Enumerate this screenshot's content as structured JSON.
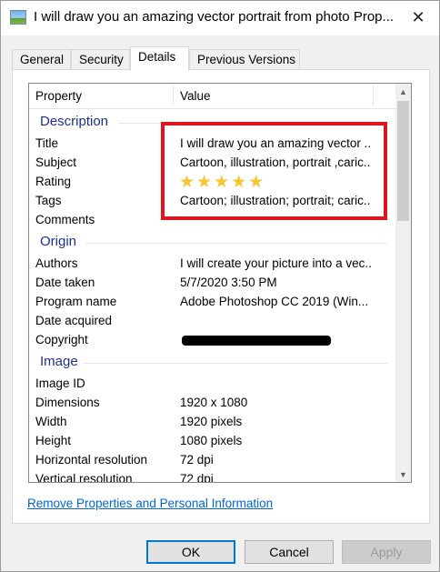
{
  "window": {
    "title": "I will draw you an amazing vector portrait from photo Prop...",
    "close_glyph": "✕"
  },
  "tabs": [
    {
      "label": "General"
    },
    {
      "label": "Security"
    },
    {
      "label": "Details",
      "active": true
    },
    {
      "label": "Previous Versions"
    }
  ],
  "list": {
    "headers": {
      "property": "Property",
      "value": "Value"
    },
    "groups": {
      "description": {
        "label": "Description",
        "rows": [
          {
            "k": "Title",
            "v": "I will draw you an amazing vector ..."
          },
          {
            "k": "Subject",
            "v": "Cartoon, illustration, portrait ,caric..."
          },
          {
            "k": "Rating",
            "v": ""
          },
          {
            "k": "Tags",
            "v": "Cartoon; illustration; portrait; caric..."
          },
          {
            "k": "Comments",
            "v": ""
          }
        ],
        "rating_stars": 5,
        "rating_glyphs": "★★★★★"
      },
      "origin": {
        "label": "Origin",
        "rows": [
          {
            "k": "Authors",
            "v": "I will create your picture into a vec..."
          },
          {
            "k": "Date taken",
            "v": "5/7/2020 3:50 PM"
          },
          {
            "k": "Program name",
            "v": "Adobe Photoshop CC 2019 (Win..."
          },
          {
            "k": "Date acquired",
            "v": ""
          },
          {
            "k": "Copyright",
            "v": ""
          }
        ]
      },
      "image": {
        "label": "Image",
        "rows": [
          {
            "k": "Image ID",
            "v": ""
          },
          {
            "k": "Dimensions",
            "v": "1920 x 1080"
          },
          {
            "k": "Width",
            "v": "1920 pixels"
          },
          {
            "k": "Height",
            "v": "1080 pixels"
          },
          {
            "k": "Horizontal resolution",
            "v": "72 dpi"
          },
          {
            "k": "Vertical resolution",
            "v": "72 dpi"
          }
        ]
      }
    }
  },
  "link": "Remove Properties and Personal Information",
  "buttons": {
    "ok": "OK",
    "cancel": "Cancel",
    "apply": "Apply"
  },
  "colors": {
    "highlight": "#e0141e",
    "group_label": "#1e3287",
    "link": "#0066cc",
    "star": "#f7c531"
  }
}
